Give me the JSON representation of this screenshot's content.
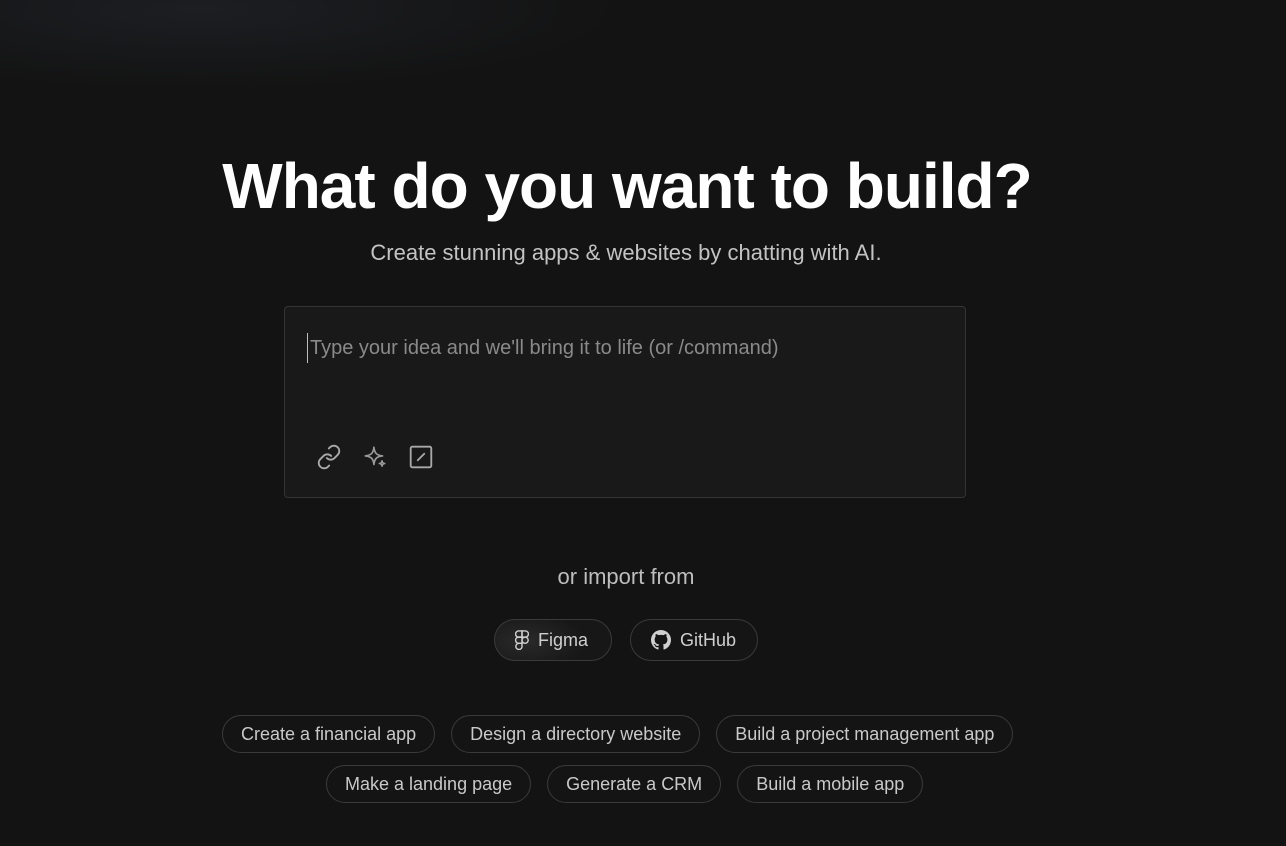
{
  "hero": {
    "title": "What do you want to build?",
    "subtitle": "Create stunning apps & websites by chatting with AI."
  },
  "prompt": {
    "placeholder": "Type your idea and we'll bring it to life (or /command)",
    "value": "",
    "tools": [
      {
        "icon": "link-icon"
      },
      {
        "icon": "sparkle-icon"
      },
      {
        "icon": "edit-square-icon"
      }
    ]
  },
  "import": {
    "label": "or import from",
    "options": [
      {
        "label": "Figma",
        "icon": "figma-icon"
      },
      {
        "label": "GitHub",
        "icon": "github-icon"
      }
    ]
  },
  "suggestions": {
    "row1": [
      "Create a financial app",
      "Design a directory website",
      "Build a project management app"
    ],
    "row2": [
      "Make a landing page",
      "Generate a CRM",
      "Build a mobile app"
    ]
  },
  "colors": {
    "background": "#131313",
    "surface": "#191919",
    "border": "#343434",
    "text_primary": "#ffffff",
    "text_secondary": "#c3c3c3",
    "placeholder": "#8a8a8a"
  }
}
